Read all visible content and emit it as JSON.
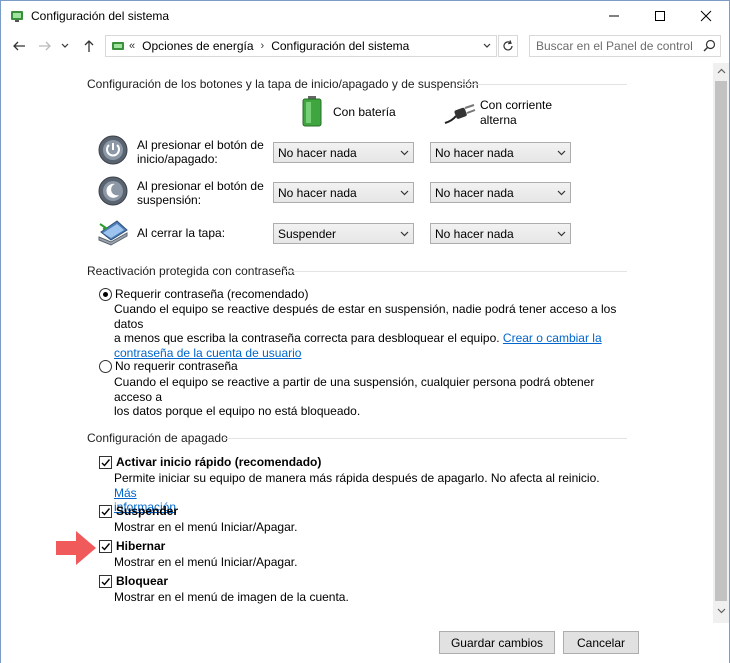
{
  "window": {
    "title": "Configuración del sistema",
    "icon": "power-options-icon"
  },
  "address_bar": {
    "overflow": "«",
    "crumbs": [
      "Opciones de energía",
      "Configuración del sistema"
    ],
    "search_placeholder": "Buscar en el Panel de control"
  },
  "buttons_section": {
    "title": "Configuración de los botones y la tapa de inicio/apagado y de suspensión",
    "col_battery": "Con batería",
    "col_ac_line1": "Con corriente",
    "col_ac_line2": "alterna",
    "rows": [
      {
        "label_line1": "Al presionar el botón de",
        "label_line2": "inicio/apagado:",
        "battery": "No hacer nada",
        "ac": "No hacer nada",
        "icon": "power-button-icon"
      },
      {
        "label_line1": "Al presionar el botón de",
        "label_line2": "suspensión:",
        "battery": "No hacer nada",
        "ac": "No hacer nada",
        "icon": "sleep-button-icon"
      },
      {
        "label_line1": "Al cerrar la tapa:",
        "label_line2": "",
        "battery": "Suspender",
        "ac": "No hacer nada",
        "icon": "laptop-lid-icon"
      }
    ]
  },
  "password_section": {
    "title": "Reactivación protegida con contraseña",
    "option1": {
      "label": "Requerir contraseña (recomendado)",
      "selected": true,
      "desc_line1": "Cuando el equipo se reactive después de estar en suspensión, nadie podrá tener acceso a los datos",
      "desc_line2_text": "a menos que escriba la contraseña correcta para desbloquear el equipo.",
      "desc_link1": "Crear o cambiar la",
      "desc_link2": "contraseña de la cuenta de usuario"
    },
    "option2": {
      "label": "No requerir contraseña",
      "selected": false,
      "desc_line1": "Cuando el equipo se reactive a partir de una suspensión, cualquier persona podrá obtener acceso a",
      "desc_line2": "los datos porque el equipo no está bloqueado."
    }
  },
  "shutdown_section": {
    "title": "Configuración de apagado",
    "items": [
      {
        "label": "Activar inicio rápido (recomendado)",
        "checked": true,
        "desc_line1": "Permite iniciar su equipo de manera más rápida después de apagarlo. No afecta al reinicio.",
        "link1": "Más",
        "link2": "información"
      },
      {
        "label": "Suspender",
        "checked": true,
        "desc": "Mostrar en el menú Iniciar/Apagar."
      },
      {
        "label": "Hibernar",
        "checked": true,
        "desc": "Mostrar en el menú Iniciar/Apagar."
      },
      {
        "label": "Bloquear",
        "checked": true,
        "desc": "Mostrar en el menú de imagen de la cuenta."
      }
    ]
  },
  "footer": {
    "save": "Guardar cambios",
    "cancel": "Cancelar"
  },
  "colors": {
    "link": "#0066cc",
    "annotation_arrow": "#f05a5a"
  }
}
